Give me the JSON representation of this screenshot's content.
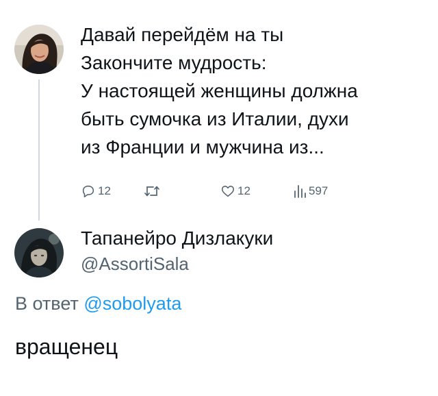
{
  "tweet": {
    "author": "Давай перейдём на ты",
    "lines": [
      "Закончите мудрость:",
      "У настоящей женщины должна",
      "быть сумочка из Италии, духи",
      "из Франции и мужчина из..."
    ],
    "actions": {
      "replies": "12",
      "retweets": "",
      "likes": "12",
      "views": "597"
    }
  },
  "reply": {
    "display_name": "Тапанейро Дизлакуки",
    "handle": "@AssortiSala",
    "reply_to_label": "В ответ",
    "reply_to_mention": "@sobolyata",
    "text": "вращенец"
  },
  "colors": {
    "text": "#0f1419",
    "secondary": "#536471",
    "link": "#1d9bf0",
    "thread_line": "#cfd9de"
  },
  "icons": [
    "reply-icon",
    "retweet-icon",
    "like-icon",
    "views-icon"
  ]
}
